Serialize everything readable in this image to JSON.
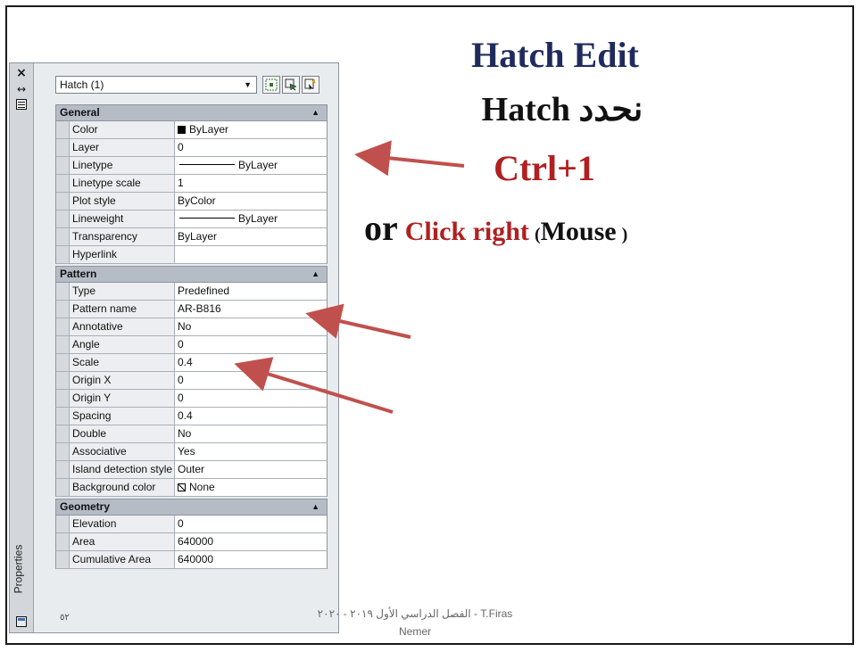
{
  "slide": {
    "title": "Hatch Edit",
    "line2": "Hatch نحدد",
    "line3": "Ctrl+1",
    "line4_or": "or",
    "line4_click": "Click right",
    "line4_open": "(",
    "line4_mouse": "Mouse",
    "line4_close": ")",
    "footer": "الفصل الدراسي الأول ٢٠١٩ - ٢٠٢٠ -  T.Firas Nemer",
    "slide_number": "٥٢"
  },
  "palette": {
    "close_glyph": "×",
    "side_label": "Properties",
    "selection": "Hatch (1)",
    "sections": [
      {
        "header": "General",
        "rows": [
          {
            "name": "Color",
            "value": "ByLayer",
            "swatch": "black"
          },
          {
            "name": "Layer",
            "value": "0"
          },
          {
            "name": "Linetype",
            "value": "ByLayer",
            "line": true
          },
          {
            "name": "Linetype scale",
            "value": "1"
          },
          {
            "name": "Plot style",
            "value": "ByColor"
          },
          {
            "name": "Lineweight",
            "value": "ByLayer",
            "line": true
          },
          {
            "name": "Transparency",
            "value": "ByLayer"
          },
          {
            "name": "Hyperlink",
            "value": ""
          }
        ]
      },
      {
        "header": "Pattern",
        "rows": [
          {
            "name": "Type",
            "value": "Predefined"
          },
          {
            "name": "Pattern name",
            "value": "AR-B816"
          },
          {
            "name": "Annotative",
            "value": "No"
          },
          {
            "name": "Angle",
            "value": "0"
          },
          {
            "name": "Scale",
            "value": "0.4"
          },
          {
            "name": "Origin X",
            "value": "0"
          },
          {
            "name": "Origin Y",
            "value": "0"
          },
          {
            "name": "Spacing",
            "value": "0.4"
          },
          {
            "name": "Double",
            "value": "No"
          },
          {
            "name": "Associative",
            "value": "Yes"
          },
          {
            "name": "Island detection style",
            "value": "Outer"
          },
          {
            "name": "Background color",
            "value": "None",
            "swatch": "none"
          }
        ]
      },
      {
        "header": "Geometry",
        "rows": [
          {
            "name": "Elevation",
            "value": "0"
          },
          {
            "name": "Area",
            "value": "640000"
          },
          {
            "name": "Cumulative Area",
            "value": "640000"
          }
        ]
      }
    ]
  },
  "colors": {
    "arrow": "#c0504d",
    "title": "#1f2b5e",
    "accent": "#b02020"
  }
}
